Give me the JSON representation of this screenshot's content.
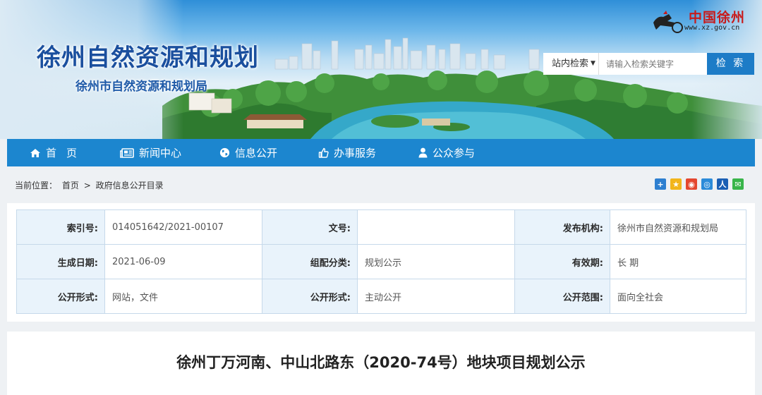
{
  "header": {
    "site_title": "徐州自然资源和规划",
    "site_subtitle": "徐州市自然资源和规划局",
    "city_logo_text": "中国徐州",
    "city_logo_url": "www.xz.gov.cn"
  },
  "search": {
    "scope_label": "站内检索",
    "placeholder": "请输入检索关键字",
    "button_label": "检 索"
  },
  "nav": {
    "items": [
      {
        "label": "首页",
        "icon": "home-icon"
      },
      {
        "label": "新闻中心",
        "icon": "newspaper-icon"
      },
      {
        "label": "信息公开",
        "icon": "globe-icon"
      },
      {
        "label": "办事服务",
        "icon": "thumbs-up-icon"
      },
      {
        "label": "公众参与",
        "icon": "user-icon"
      }
    ]
  },
  "breadcrumb": {
    "prefix": "当前位置：",
    "items": [
      "首页",
      ">",
      "政府信息公开目录"
    ]
  },
  "share_icons": [
    {
      "icon": "plus-share-icon",
      "color": "#2d7fd0"
    },
    {
      "icon": "qzone-share-icon",
      "color": "#f2b51b"
    },
    {
      "icon": "weibo-share-icon",
      "color": "#e4472f"
    },
    {
      "icon": "tencent-weibo-share-icon",
      "color": "#2b8bd9"
    },
    {
      "icon": "renren-share-icon",
      "color": "#1a5fb4"
    },
    {
      "icon": "wechat-share-icon",
      "color": "#39b54a"
    }
  ],
  "meta": {
    "rows": [
      [
        {
          "label": "索引号:",
          "value": "014051642/2021-00107"
        },
        {
          "label": "文号:",
          "value": ""
        },
        {
          "label": "发布机构:",
          "value": "徐州市自然资源和规划局"
        }
      ],
      [
        {
          "label": "生成日期:",
          "value": "2021-06-09"
        },
        {
          "label": "组配分类:",
          "value": "规划公示"
        },
        {
          "label": "有效期:",
          "value": "长 期"
        }
      ],
      [
        {
          "label": "公开形式:",
          "value": "网站，文件"
        },
        {
          "label": "公开形式:",
          "value": "主动公开"
        },
        {
          "label": "公开范围:",
          "value": "面向全社会"
        }
      ]
    ]
  },
  "article": {
    "title": "徐州丁万河南、中山北路东（2020-74号）地块项目规划公示"
  },
  "colors": {
    "nav_bg": "#1c86cf",
    "title_blue": "#1a4f9e",
    "search_button": "#1d7cc7",
    "label_cell_bg": "#e9f3fb",
    "logo_red": "#c81a1a"
  }
}
